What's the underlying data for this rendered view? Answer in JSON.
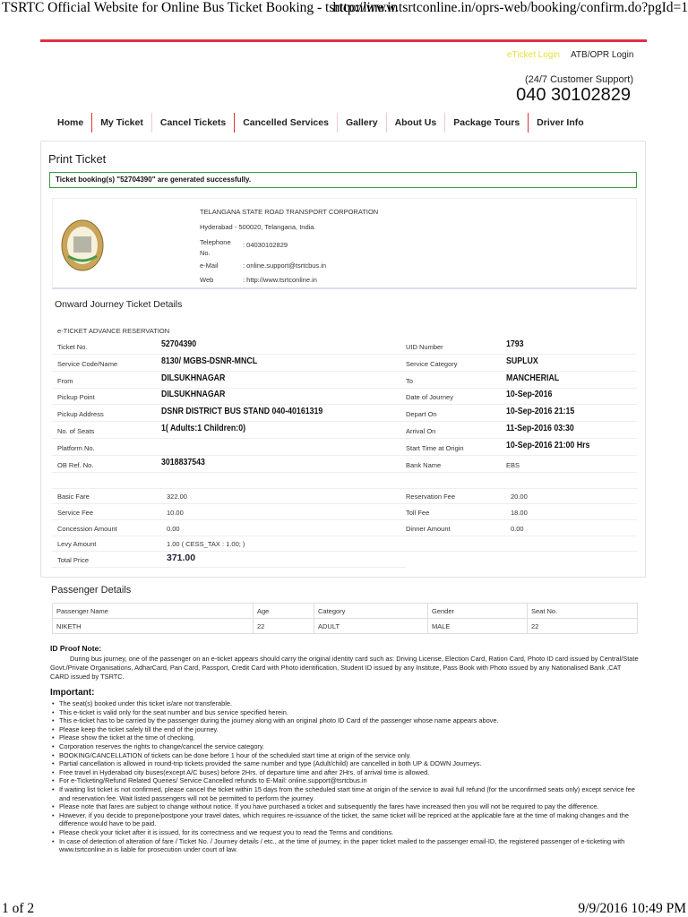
{
  "browser": {
    "title": "TSRTC Official Website for Online Bus Ticket Booking - tsrtconline.in",
    "url": "http://www.tsrtconline.in/oprs-web/booking/confirm.do?pgId=1"
  },
  "header": {
    "eticket_login": "eTicket Login",
    "atb_login": "ATB/OPR Login",
    "support_label": "(24/7 Customer Support)",
    "support_phone": "040 30102829",
    "accent": "#e0313f"
  },
  "nav": [
    "Home",
    "My Ticket",
    "Cancel Tickets",
    "Cancelled Services",
    "Gallery",
    "About Us",
    "Package Tours",
    "Driver Info"
  ],
  "page_title": "Print Ticket",
  "success_msg": "Ticket booking(s) \"52704390\" are generated successfully.",
  "org": {
    "name": "TELANGANA STATE ROAD TRANSPORT CORPORATION",
    "address": "Hyderabad - 500020, Telangana, India.",
    "tel_label": "Telephone No.",
    "tel": ": 04030102829",
    "email_label": "e-Mail",
    "email": ": online.support@tsrtcbus.in",
    "web_label": "Web",
    "web": ": http://www.tsrtconline.in"
  },
  "journey": {
    "title": "Onward Journey Ticket Details",
    "subtitle": "e-TICKET ADVANCE RESERVATION",
    "rows": [
      {
        "l1": "Ticket No.",
        "v1": "52704390",
        "l2": "UID Number",
        "v2": "1793"
      },
      {
        "l1": "Service Code/Name",
        "v1": "8130/ MGBS-DSNR-MNCL",
        "l2": "Service Category",
        "v2": "SUPLUX"
      },
      {
        "l1": "From",
        "v1": "DILSUKHNAGAR",
        "l2": "To",
        "v2": "MANCHERIAL"
      },
      {
        "l1": "Pickup Point",
        "v1": "DILSUKHNAGAR",
        "l2": "Date of Journey",
        "v2": "10-Sep-2016"
      },
      {
        "l1": "Pickup Address",
        "v1": "DSNR DISTRICT BUS STAND 040-40161319",
        "l2": "Depart On",
        "v2": "10-Sep-2016 21:15"
      },
      {
        "l1": "No. of Seats",
        "v1": "1( Adults:1  Children:0)",
        "l2": "Arrival On",
        "v2": "11-Sep-2016 03:30"
      },
      {
        "l1": "Platform No.",
        "v1": "",
        "l2": "Start Time at Origin",
        "v2": "10-Sep-2016 21:00 Hrs"
      },
      {
        "l1": "OB Ref. No.",
        "v1": "3018837543",
        "l2": "Bank Name",
        "v2": "EBS"
      }
    ]
  },
  "fare": {
    "rows": [
      {
        "l1": "Basic Fare",
        "v1": "322.00",
        "l2": "Reservation Fee",
        "v2": "20.00"
      },
      {
        "l1": "Service Fee",
        "v1": "10.00",
        "l2": "Toll Fee",
        "v2": "18.00"
      },
      {
        "l1": "Concession Amount",
        "v1": "0.00",
        "l2": "Dinner Amount",
        "v2": "0.00"
      },
      {
        "l1": "Levy Amount",
        "v1": "1.00  ( CESS_TAX : 1.00;  )",
        "l2": "",
        "v2": ""
      }
    ],
    "total_label": "Total Price",
    "total": "371.00"
  },
  "passengers": {
    "title": "Passenger Details",
    "headers": [
      "Passenger Name",
      "Age",
      "Category",
      "Gender",
      "Seat No."
    ],
    "rows": [
      [
        "NIKETH",
        "22",
        "ADULT",
        "MALE",
        "22"
      ]
    ]
  },
  "id_proof": {
    "title": "ID Proof Note:",
    "text": "During bus journey, one of the passenger on an e-ticket appears should carry the original identity card such as: Driving License, Election Card, Ration Card, Photo ID card issued by Central/State Govt./Private Organisations, AdharCard, Pan Card, Passport, Credit Card with Photo identification, Student ID issued by any Institute, Pass Book with Photo issued by any Nationalised Bank ,CAT CARD issued by TSRTC."
  },
  "important": {
    "title": "Important:",
    "items": [
      "The seat(s) booked under this ticket is/are not transferable.",
      "This e-ticket is valid only for the seat number and bus service specified herein.",
      "This e-ticket has to be carried by the passenger during the journey along with an original photo ID Card of the passenger whose name appears above.",
      "Please keep the ticket safely till the end of the journey.",
      "Please show the ticket at the time of checking.",
      "Corporation reserves the rights to change/cancel the service category.",
      "BOOKING/CANCELLATION of tickets can be done before 1 hour of the scheduled start time at origin of the service only.",
      "Partial cancellation is allowed in round-trip tickets provided the same number and type (Adult/child) are cancelled in both UP & DOWN Journeys.",
      "Free travel in Hyderabad city buses(except A/C buses) before 2Hrs. of departure time and after 2Hrs. of arrival time is allowed.",
      "For e-Ticketing/Refund Related Queries/ Service Cancelled refunds to E-Mail: online.support@tsrtcbus.in",
      "If waiting list ticket is not confirmed, please cancel the ticket within 15 days from the scheduled start time at origin of the service to avail full refund (for the unconfirmed seats only) except service fee and reservation fee. Wait listed passengers will not be permitted to perform the journey.",
      "Please note that fares are subject to change without notice. If you have purchased a ticket and subsequently the fares have increased then you will not be required to pay the difference.",
      "However, if you decide to prepone/postpone your travel dates, which requires re-issuance of the ticket, the same ticket will be repriced at the applicable fare at the time of making changes and the difference would have to be paid.",
      "Please check your ticket after it is issued, for its correctness and we request you to read the Terms and conditions.",
      "In case of detection of alteration of fare / Ticket No. / Journey details / etc., at the time of journey, in the paper ticket mailed to the passenger email-ID, the registered passenger of e-ticketing with www.tsrtconline.in is liable for prosecution under court of law."
    ]
  },
  "footer": {
    "page": "1 of 2",
    "datetime": "9/9/2016 10:49 PM"
  }
}
